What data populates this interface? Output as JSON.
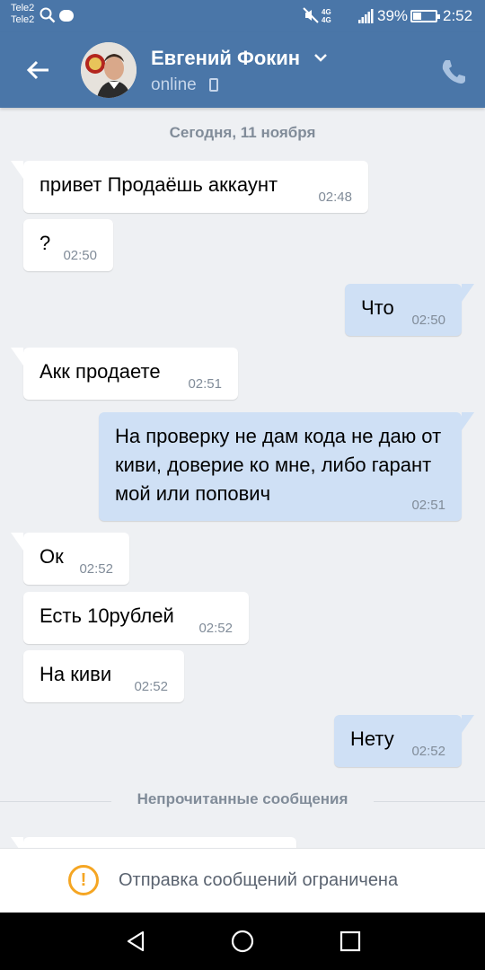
{
  "status_bar": {
    "carrier_1": "Tele2",
    "carrier_2": "Tele2",
    "network_line_1": "4G",
    "network_line_2": "4G",
    "battery_percent": "39%",
    "battery_level": 0.39,
    "time": "2:52"
  },
  "header": {
    "contact_name": "Евгений Фокин",
    "status": "online",
    "icons": [
      "back-arrow-icon",
      "chevron-down-icon",
      "mobile-device-icon",
      "phone-icon"
    ]
  },
  "chat": {
    "date_separator": "Сегодня, 11 ноября",
    "messages": [
      {
        "direction": "in",
        "text": "привет Продаёшь аккаунт",
        "time": "02:48"
      },
      {
        "direction": "in",
        "text": "?",
        "time": "02:50"
      },
      {
        "direction": "out",
        "text": "Что",
        "time": "02:50"
      },
      {
        "direction": "in",
        "text": "Акк продаете",
        "time": "02:51"
      },
      {
        "direction": "out",
        "text": "На проверку не дам кода не даю от киви, доверие ко мне, либо гарант мой или попович",
        "time": "02:51"
      },
      {
        "direction": "in",
        "text": "Ок",
        "time": "02:52"
      },
      {
        "direction": "in",
        "text": "Есть 10рублей",
        "time": "02:52"
      },
      {
        "direction": "in",
        "text": "На киви",
        "time": "02:52"
      },
      {
        "direction": "out",
        "text": "Нету",
        "time": "02:52"
      }
    ],
    "unread_separator": "Непрочитанные сообщения"
  },
  "restricted_bar": {
    "text": "Отправка сообщений ограничена",
    "icon": "warning-icon",
    "accent_color": "#f5a623"
  },
  "nav_bar": {
    "icons": [
      "back-triangle-icon",
      "home-circle-icon",
      "recents-square-icon"
    ]
  },
  "colors": {
    "header": "#4a76a8",
    "chat_background": "#eef0f3",
    "outgoing_bubble": "#cfe0f5",
    "incoming_bubble": "#ffffff"
  }
}
